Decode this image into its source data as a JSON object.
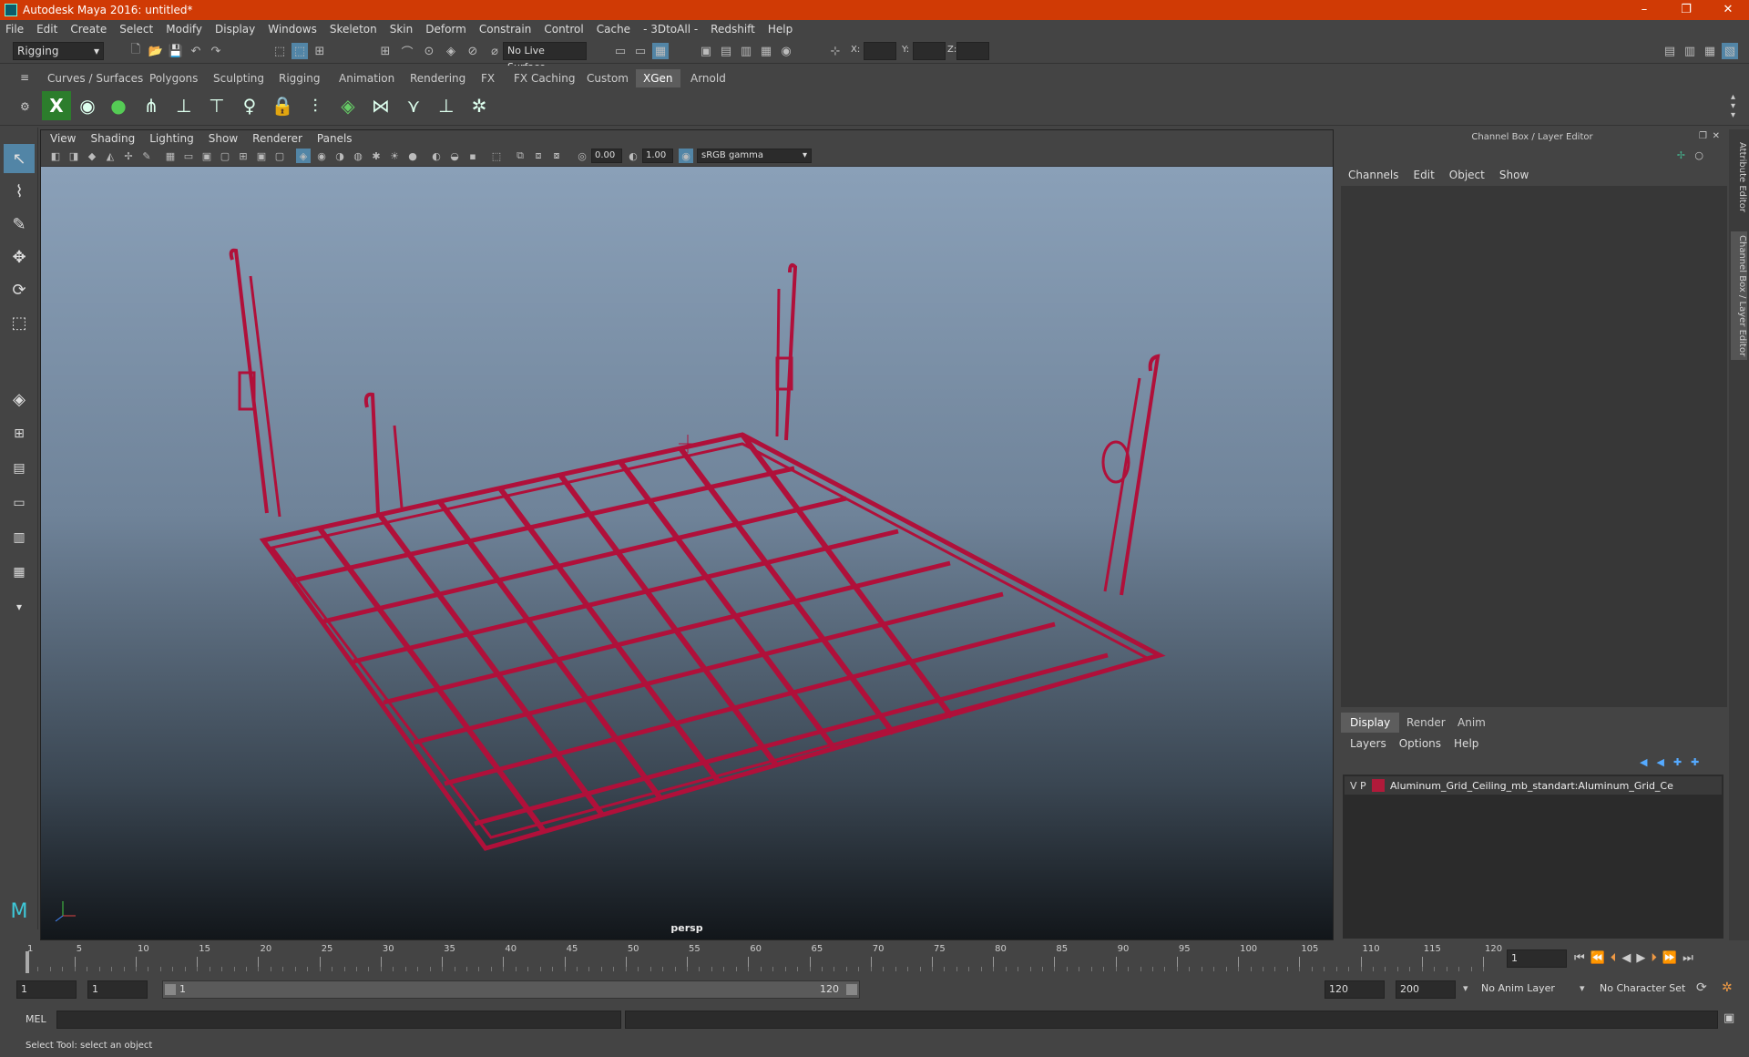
{
  "window": {
    "title": "Autodesk Maya 2016: untitled*",
    "min": "–",
    "max": "❐",
    "close": "✕"
  },
  "menubar": [
    "File",
    "Edit",
    "Create",
    "Select",
    "Modify",
    "Display",
    "Windows",
    "Skeleton",
    "Skin",
    "Deform",
    "Constrain",
    "Control",
    "Cache",
    "- 3DtoAll -",
    "Redshift",
    "Help"
  ],
  "status": {
    "menuset": "Rigging",
    "live_surface": "No Live Surface",
    "x_label": "X:",
    "y_label": "Y:",
    "z_label": "Z:"
  },
  "shelf_tabs": [
    "Curves / Surfaces",
    "Polygons",
    "Sculpting",
    "Rigging",
    "Animation",
    "Rendering",
    "FX",
    "FX Caching",
    "Custom",
    "XGen",
    "Arnold"
  ],
  "shelf_active": "XGen",
  "viewport": {
    "menu": [
      "View",
      "Shading",
      "Lighting",
      "Show",
      "Renderer",
      "Panels"
    ],
    "exposure": "0.00",
    "gamma": "1.00",
    "colorspace": "sRGB gamma",
    "camera": "persp"
  },
  "channelbox": {
    "header": "Channel Box / Layer Editor",
    "menu": [
      "Channels",
      "Edit",
      "Object",
      "Show"
    ]
  },
  "layers": {
    "tabs": [
      "Display",
      "Render",
      "Anim"
    ],
    "active_tab": "Display",
    "menu": [
      "Layers",
      "Options",
      "Help"
    ],
    "row": {
      "v": "V",
      "p": "P",
      "name": "Aluminum_Grid_Ceiling_mb_standart:Aluminum_Grid_Ce",
      "color": "#b01a3a"
    }
  },
  "side_tabs": [
    "Attribute Editor",
    "Channel Box / Layer Editor"
  ],
  "timeline": {
    "ticks": [
      "1",
      "5",
      "10",
      "15",
      "20",
      "25",
      "30",
      "35",
      "40",
      "45",
      "50",
      "55",
      "60",
      "65",
      "70",
      "75",
      "80",
      "85",
      "90",
      "95",
      "100",
      "105",
      "110",
      "115",
      "120"
    ],
    "current_frame": "1"
  },
  "range": {
    "start": "1",
    "playback_start": "1",
    "slider_start": "1",
    "slider_end": "120",
    "playback_end": "120",
    "end": "200",
    "anim_layer": "No Anim Layer",
    "char_set": "No Character Set"
  },
  "command": {
    "lang": "MEL"
  },
  "help_line": "Select Tool: select an object",
  "colors": {
    "title_bar": "#d03a05",
    "wireframe": "#b0103a",
    "selected_tool": "#5285a6"
  }
}
